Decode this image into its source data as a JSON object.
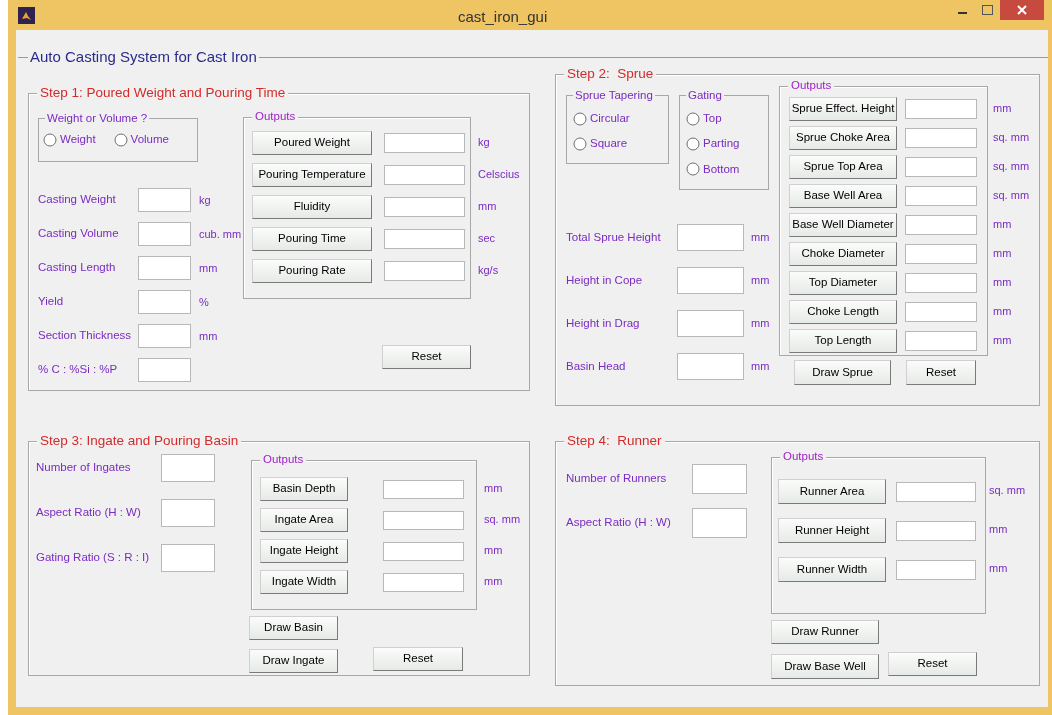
{
  "window": {
    "title": "cast_iron_gui"
  },
  "main_panel": {
    "title": "Auto Casting System for Cast Iron"
  },
  "columns": [
    {
      "steps": [
        {
          "title": "Step 1: Poured Weight and Pouring Time",
          "radio_groups": [
            {
              "title": "Weight or Volume ?",
              "options": [
                {
                  "label": "Weight",
                  "selected": false
                },
                {
                  "label": "Volume",
                  "selected": false
                }
              ]
            }
          ],
          "inputs": [
            {
              "label": "Casting Weight",
              "unit": "kg"
            },
            {
              "label": "Casting Volume",
              "unit": "cub. mm"
            },
            {
              "label": "Casting Length",
              "unit": "mm"
            },
            {
              "label": "Yield",
              "unit": "%"
            },
            {
              "label": "Section Thickness",
              "unit": "mm"
            },
            {
              "label": "% C : %Si : %P"
            }
          ],
          "outputs": {
            "title": "Outputs",
            "rows": [
              {
                "button": "Poured Weight",
                "unit": "kg"
              },
              {
                "button": "Pouring Temperature",
                "unit": "Celscius"
              },
              {
                "button": "Fluidity",
                "unit": "mm"
              },
              {
                "button": "Pouring Time",
                "unit": "sec"
              },
              {
                "button": "Pouring Rate",
                "unit": "kg/s"
              }
            ]
          },
          "buttons": [
            "Reset"
          ]
        },
        {
          "title": "Step 3: Ingate and Pouring Basin",
          "inputs": [
            {
              "label": "Number of Ingates"
            },
            {
              "label": "Aspect Ratio (H : W)"
            },
            {
              "label": "Gating Ratio (S : R : I)"
            }
          ],
          "outputs": {
            "title": "Outputs",
            "rows": [
              {
                "button": "Basin Depth",
                "unit": "mm"
              },
              {
                "button": "Ingate Area",
                "unit": "sq. mm"
              },
              {
                "button": "Ingate Height",
                "unit": "mm"
              },
              {
                "button": "Ingate Width",
                "unit": "mm"
              }
            ]
          },
          "buttons": [
            "Draw Basin",
            "Draw Ingate",
            "Reset"
          ]
        }
      ]
    },
    {
      "steps": [
        {
          "title": "Step 2:  Sprue",
          "radio_groups": [
            {
              "title": "Sprue Tapering",
              "options": [
                {
                  "label": "Circular",
                  "selected": false
                },
                {
                  "label": "Square",
                  "selected": false
                }
              ]
            },
            {
              "title": "Gating",
              "options": [
                {
                  "label": "Top",
                  "selected": false
                },
                {
                  "label": "Parting",
                  "selected": false
                },
                {
                  "label": "Bottom",
                  "selected": false
                }
              ]
            }
          ],
          "inputs": [
            {
              "label": "Total Sprue Height",
              "unit": "mm"
            },
            {
              "label": "Height in Cope",
              "unit": "mm"
            },
            {
              "label": "Height in Drag",
              "unit": "mm"
            },
            {
              "label": "Basin Head",
              "unit": "mm"
            }
          ],
          "outputs": {
            "title": "Outputs",
            "rows": [
              {
                "button": "Sprue Effect. Height",
                "unit": "mm"
              },
              {
                "button": "Sprue Choke Area",
                "unit": "sq. mm"
              },
              {
                "button": "Sprue Top Area",
                "unit": "sq. mm"
              },
              {
                "button": "Base Well Area",
                "unit": "sq. mm"
              },
              {
                "button": "Base Well Diameter",
                "unit": "mm"
              },
              {
                "button": "Choke Diameter",
                "unit": "mm"
              },
              {
                "button": "Top Diameter",
                "unit": "mm"
              },
              {
                "button": "Choke Length",
                "unit": "mm"
              },
              {
                "button": "Top Length",
                "unit": "mm"
              }
            ]
          },
          "buttons": [
            "Draw Sprue",
            "Reset"
          ]
        },
        {
          "title": "Step 4:  Runner",
          "inputs": [
            {
              "label": "Number of Runners"
            },
            {
              "label": "Aspect Ratio (H : W)"
            }
          ],
          "outputs": {
            "title": "Outputs",
            "rows": [
              {
                "button": "Runner Area",
                "unit": "sq. mm"
              },
              {
                "button": "Runner Height",
                "unit": "mm"
              },
              {
                "button": "Runner Width",
                "unit": "mm"
              }
            ]
          },
          "buttons": [
            "Draw Runner",
            "Draw Base Well",
            "Reset"
          ]
        }
      ]
    }
  ]
}
